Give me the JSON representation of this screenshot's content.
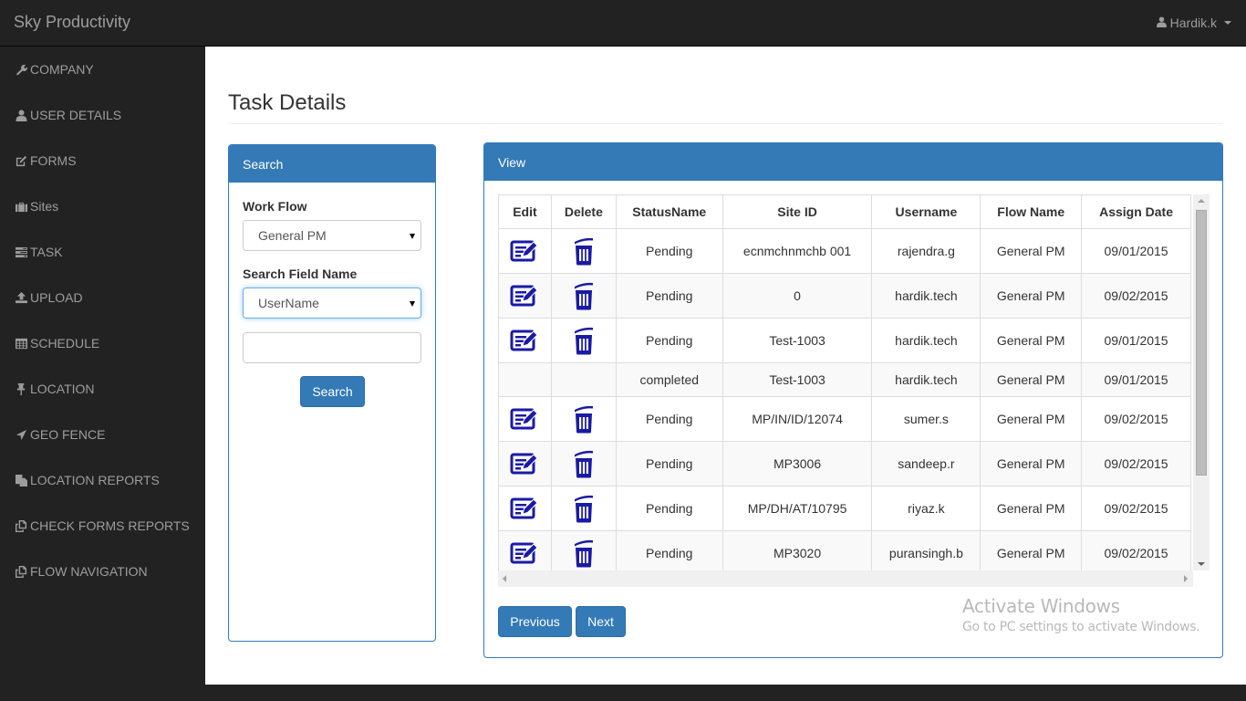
{
  "app": {
    "brand": "Sky Productivity",
    "user": {
      "name": "Hardik.k",
      "icon": "user-icon"
    }
  },
  "sidebar": {
    "items": [
      {
        "label": "COMPANY",
        "icon": "wrench-icon"
      },
      {
        "label": "USER DETAILS",
        "icon": "user-icon"
      },
      {
        "label": "FORMS",
        "icon": "edit-icon"
      },
      {
        "label": "Sites",
        "icon": "briefcase-icon"
      },
      {
        "label": "TASK",
        "icon": "tasks-icon"
      },
      {
        "label": "UPLOAD",
        "icon": "upload-icon"
      },
      {
        "label": "SCHEDULE",
        "icon": "calendar-grid-icon"
      },
      {
        "label": "LOCATION",
        "icon": "pushpin-icon"
      },
      {
        "label": "GEO FENCE",
        "icon": "send-arrow-icon"
      },
      {
        "label": "LOCATION REPORTS",
        "icon": "documents-icon"
      },
      {
        "label": "CHECK FORMS REPORTS",
        "icon": "copy-icon"
      },
      {
        "label": "FLOW NAVIGATION",
        "icon": "copy-icon"
      }
    ]
  },
  "page": {
    "title": "Task Details"
  },
  "search_panel": {
    "heading": "Search",
    "workflow_label": "Work Flow",
    "workflow_value": "General PM",
    "field_label": "Search Field Name",
    "field_value": "UserName",
    "query_value": "",
    "search_button": "Search"
  },
  "view_panel": {
    "heading": "View",
    "columns": [
      "Edit",
      "Delete",
      "StatusName",
      "Site ID",
      "Username",
      "Flow Name",
      "Assign Date"
    ],
    "rows": [
      {
        "actions": true,
        "status": "Pending",
        "site_id": "ecnmchnmchb 001",
        "username": "rajendra.g",
        "flow": "General PM",
        "date": "09/01/2015"
      },
      {
        "actions": true,
        "status": "Pending",
        "site_id": "0",
        "username": "hardik.tech",
        "flow": "General PM",
        "date": "09/02/2015"
      },
      {
        "actions": true,
        "status": "Pending",
        "site_id": "Test-1003",
        "username": "hardik.tech",
        "flow": "General PM",
        "date": "09/01/2015"
      },
      {
        "actions": false,
        "status": "completed",
        "site_id": "Test-1003",
        "username": "hardik.tech",
        "flow": "General PM",
        "date": "09/01/2015"
      },
      {
        "actions": true,
        "status": "Pending",
        "site_id": "MP/IN/ID/12074",
        "username": "sumer.s",
        "flow": "General PM",
        "date": "09/02/2015"
      },
      {
        "actions": true,
        "status": "Pending",
        "site_id": "MP3006",
        "username": "sandeep.r",
        "flow": "General PM",
        "date": "09/02/2015"
      },
      {
        "actions": true,
        "status": "Pending",
        "site_id": "MP/DH/AT/10795",
        "username": "riyaz.k",
        "flow": "General PM",
        "date": "09/02/2015"
      },
      {
        "actions": true,
        "status": "Pending",
        "site_id": "MP3020",
        "username": "puransingh.b",
        "flow": "General PM",
        "date": "09/02/2015"
      }
    ],
    "previous_button": "Previous",
    "next_button": "Next"
  },
  "watermark": {
    "title": "Activate Windows",
    "subtitle": "Go to PC settings to activate Windows."
  },
  "colors": {
    "primary": "#337ab7",
    "navbar": "#222222",
    "nav_text": "#9d9d9d",
    "action_icon": "#1a1aa6"
  }
}
